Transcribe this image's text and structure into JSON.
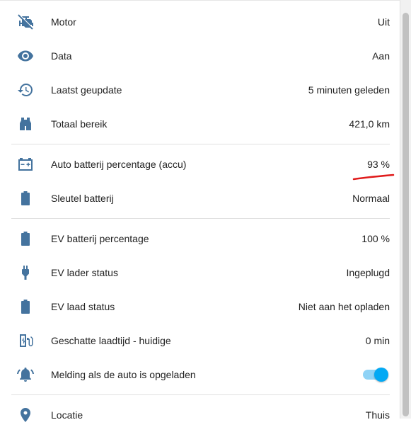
{
  "colors": {
    "icon": "#44739e",
    "toggle_on": "#03a9f4",
    "annotation": "#e01b1b"
  },
  "rows": [
    {
      "icon": "engine-off-icon",
      "label": "Motor",
      "value": "Uit"
    },
    {
      "icon": "eye-icon",
      "label": "Data",
      "value": "Aan"
    },
    {
      "icon": "history-icon",
      "label": "Laatst geupdate",
      "value": "5 minuten geleden"
    },
    {
      "icon": "binoculars-icon",
      "label": "Totaal bereik",
      "value": "421,0 km"
    },
    {
      "icon": "car-battery-icon",
      "label": "Auto batterij percentage (accu)",
      "value": "93 %"
    },
    {
      "icon": "battery-icon",
      "label": "Sleutel batterij",
      "value": "Normaal"
    },
    {
      "icon": "battery-icon",
      "label": "EV batterij percentage",
      "value": "100 %"
    },
    {
      "icon": "power-plug-icon",
      "label": "EV lader status",
      "value": "Ingeplugd"
    },
    {
      "icon": "battery-icon",
      "label": "EV laad status",
      "value": "Niet aan het opladen"
    },
    {
      "icon": "ev-station-icon",
      "label": "Geschatte laadtijd - huidige",
      "value": "0 min"
    },
    {
      "icon": "bell-ring-icon",
      "label": "Melding als de auto is opgeladen",
      "toggle": true
    },
    {
      "icon": "map-marker-icon",
      "label": "Locatie",
      "value": "Thuis"
    }
  ]
}
